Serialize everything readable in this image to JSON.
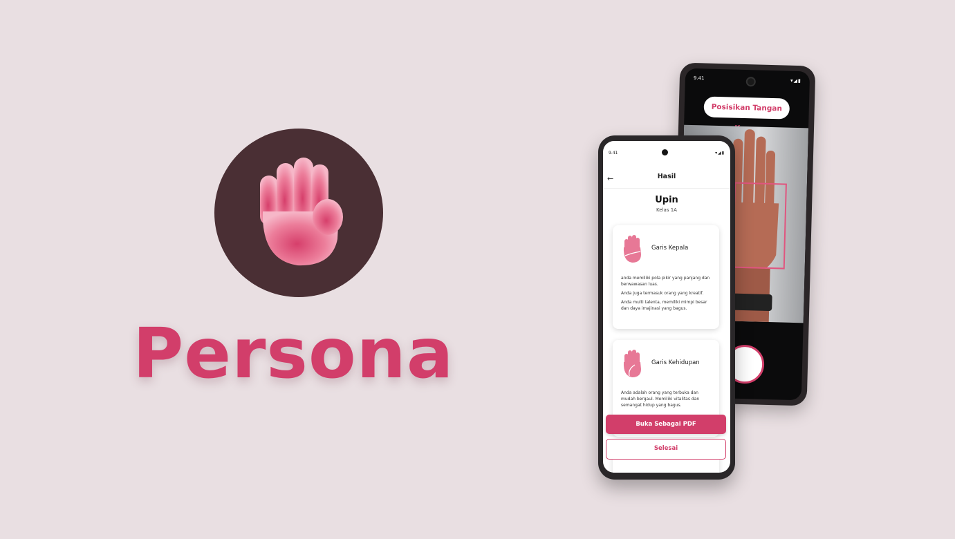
{
  "brand": {
    "name": "Persona",
    "accent": "#d23e6a",
    "logo_bg": "#4a2f34"
  },
  "camera_screen": {
    "status_time": "9.41",
    "status_icons": "▾◢▮",
    "instruction_pill": "Posisikan Tangan Kamu"
  },
  "result_screen": {
    "status_time": "9.41",
    "status_icons": "▾◢▮",
    "title": "Hasil",
    "back_icon": "arrow-left-icon",
    "student_name": "Upin",
    "student_class": "Kelas 1A",
    "cards": [
      {
        "title": "Garis Kepala",
        "paragraphs": [
          "anda memiliki pola pikir yang panjang dan berwawasan luas.",
          "Anda juga termasuk orang yang kreatif.",
          "Anda multi talenta, memiliki mimpi besar dan daya imajinasi yang bagus."
        ]
      },
      {
        "title": "Garis Kehidupan",
        "paragraphs": [
          "Anda adalah orang yang terbuka dan mudah bergaul. Memiliki vitalitas dan semangat hidup yang bagus."
        ]
      }
    ],
    "primary_button": "Buka Sebagai PDF",
    "secondary_button": "Selesai"
  }
}
